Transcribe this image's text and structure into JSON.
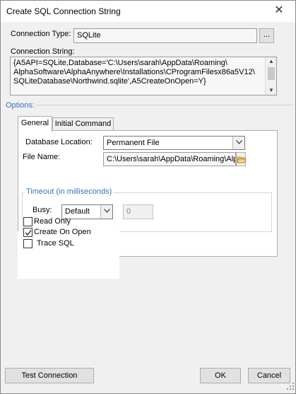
{
  "window": {
    "title": "Create SQL Connection String"
  },
  "connection_type": {
    "label": "Connection Type:",
    "value": "SQLite",
    "browse_label": "..."
  },
  "connection_string": {
    "label": "Connection String:",
    "lines": [
      "{A5API=SQLite,Database='C:\\Users\\sarah\\AppData\\Roaming\\",
      "AlphaSoftware\\AlphaAnywhere\\Installations\\CProgramFilesx86a5V12\\",
      "SQLiteDatabase\\Northwind.sqlite',A5CreateOnOpen=Y}"
    ]
  },
  "options": {
    "label": "Options:"
  },
  "tabs": [
    {
      "label": "General",
      "active": true
    },
    {
      "label": "Initial Command",
      "active": false
    }
  ],
  "general": {
    "db_location": {
      "label": "Database Location:",
      "value": "Permanent File"
    },
    "file_name": {
      "label": "File Name:",
      "value": "C:\\Users\\sarah\\AppData\\Roaming\\AlphaSoftware\\"
    },
    "timeout": {
      "title": "Timeout (in milliseconds)",
      "busy_label": "Busy:",
      "busy_mode": "Default",
      "busy_value": "0"
    },
    "checkboxes": [
      {
        "label": "Read Only",
        "checked": false
      },
      {
        "label": "Create On Open",
        "checked": true
      },
      {
        "label": "Trace SQL",
        "checked": false
      }
    ]
  },
  "buttons": {
    "test": "Test Connection",
    "ok": "OK",
    "cancel": "Cancel"
  },
  "icons": {
    "close": "close-icon",
    "folder": "folder-open-icon",
    "dropdown": "chevron-down-icon",
    "check": "check-icon"
  }
}
